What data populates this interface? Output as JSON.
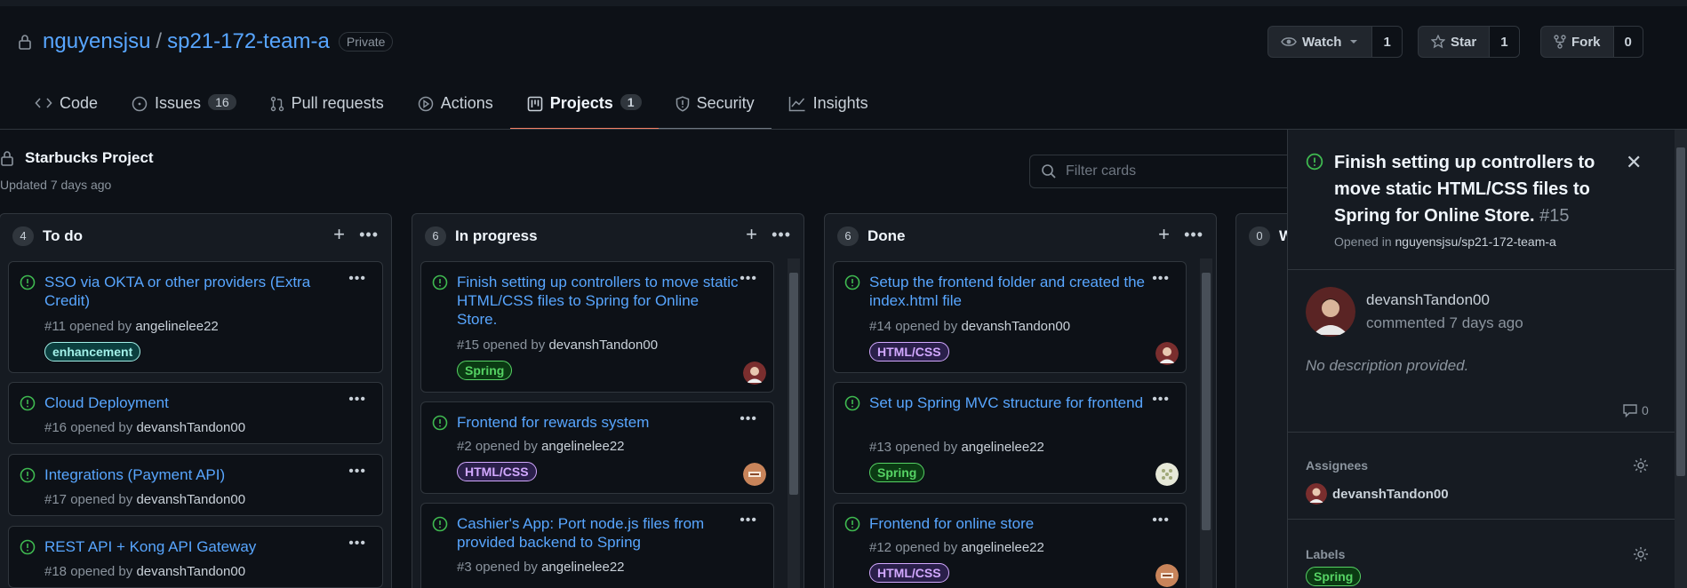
{
  "repo": {
    "owner": "nguyensjsu",
    "separator": "/",
    "name": "sp21-172-team-a",
    "visibility": "Private",
    "watch": {
      "label": "Watch",
      "count": "1"
    },
    "star": {
      "label": "Star",
      "count": "1"
    },
    "fork": {
      "label": "Fork",
      "count": "0"
    }
  },
  "tabs": [
    {
      "label": "Code"
    },
    {
      "label": "Issues",
      "count": "16"
    },
    {
      "label": "Pull requests"
    },
    {
      "label": "Actions"
    },
    {
      "label": "Projects",
      "count": "1"
    },
    {
      "label": "Security"
    },
    {
      "label": "Insights"
    }
  ],
  "project": {
    "title": "Starbucks Project",
    "updated": "Updated 7 days ago",
    "filter_placeholder": "Filter cards"
  },
  "columns": [
    {
      "count": "4",
      "name": "To do",
      "cards": [
        {
          "title": "SSO via OKTA or other providers (Extra Credit)",
          "meta": "#11 opened by",
          "author": "angelinelee22",
          "label": "enhancement"
        },
        {
          "title": "Cloud Deployment",
          "meta": "#16 opened by",
          "author": "devanshTandon00"
        },
        {
          "title": "Integrations (Payment API)",
          "meta": "#17 opened by",
          "author": "devanshTandon00"
        },
        {
          "title": "REST API + Kong API Gateway",
          "meta": "#18 opened by",
          "author": "devanshTandon00"
        }
      ]
    },
    {
      "count": "6",
      "name": "In progress",
      "cards": [
        {
          "title": "Finish setting up controllers to move static HTML/CSS files to Spring for Online Store.",
          "meta": "#15 opened by",
          "author": "devanshTandon00",
          "label": "Spring"
        },
        {
          "title": "Frontend for rewards system",
          "meta": "#2 opened by",
          "author": "angelinelee22",
          "label": "HTML/CSS"
        },
        {
          "title": "Cashier's App: Port node.js files from provided backend to Spring",
          "meta": "#3 opened by",
          "author": "angelinelee22"
        }
      ]
    },
    {
      "count": "6",
      "name": "Done",
      "cards": [
        {
          "title": "Setup the frontend folder and created the index.html file",
          "meta": "#14 opened by",
          "author": "devanshTandon00",
          "label": "HTML/CSS"
        },
        {
          "title": "Set up Spring MVC structure for frontend",
          "meta": "#13 opened by",
          "author": "angelinelee22",
          "label": "Spring"
        },
        {
          "title": "Frontend for online store",
          "meta": "#12 opened by",
          "author": "angelinelee22",
          "label": "HTML/CSS"
        }
      ]
    },
    {
      "count": "0",
      "name": "W"
    }
  ],
  "side_panel": {
    "title": "Finish setting up controllers to move static HTML/CSS files to Spring for Online Store.",
    "number": "#15",
    "opened_prefix": "Opened in",
    "opened_repo": "nguyensjsu/sp21-172-team-a",
    "user": "devanshTandon00",
    "commented": "commented 7 days ago",
    "description": "No description provided.",
    "comment_count": "0",
    "assignees_label": "Assignees",
    "assignee": "devanshTandon00",
    "labels_label": "Labels",
    "label": "Spring"
  },
  "colors": {
    "bg": "#0d1117",
    "panel": "#161b22",
    "link": "#58a6ff",
    "open_issue_green": "#3fb950",
    "selected_tab_underline": "#f78166"
  }
}
